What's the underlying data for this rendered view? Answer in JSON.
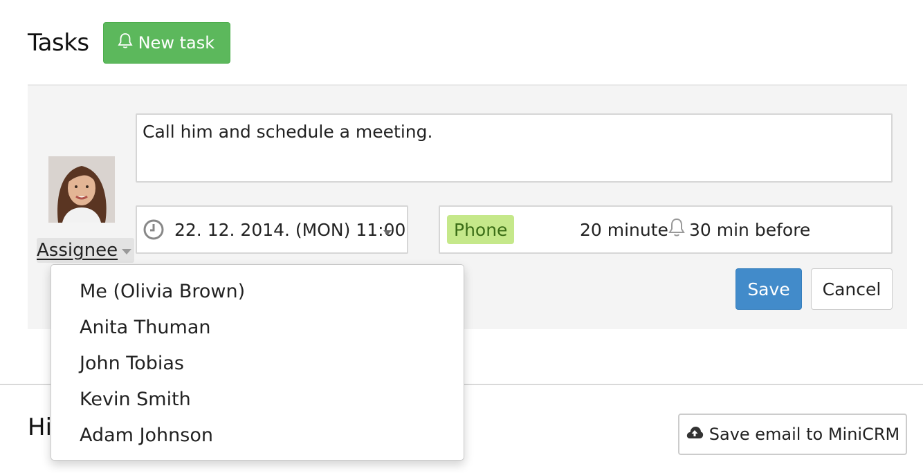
{
  "header": {
    "title": "Tasks",
    "new_task_label": "New task"
  },
  "task_form": {
    "description": "Call him and schedule a meeting.",
    "assignee_label": "Assignee",
    "datetime": "22. 12. 2014. (MON) 11:00",
    "type_badge": "Phone",
    "duration": "20 minute",
    "reminder": "30 min before",
    "save_label": "Save",
    "cancel_label": "Cancel"
  },
  "assignee_menu": {
    "items": [
      {
        "label": "Me (Olivia Brown)"
      },
      {
        "label": "Anita Thuman"
      },
      {
        "label": "John Tobias"
      },
      {
        "label": "Kevin Smith"
      },
      {
        "label": "Adam Johnson"
      }
    ]
  },
  "history": {
    "title": "Hi",
    "save_email_label": "Save email to MiniCRM"
  },
  "icons": {
    "new_task": "bell-icon",
    "datetime": "clock-icon",
    "reminder": "bell-icon",
    "save_email": "cloud-upload-icon"
  },
  "colors": {
    "primary_green": "#5cb85c",
    "primary_blue": "#428bca",
    "badge_green": "#c5e88a",
    "panel_bg": "#f4f4f4"
  }
}
